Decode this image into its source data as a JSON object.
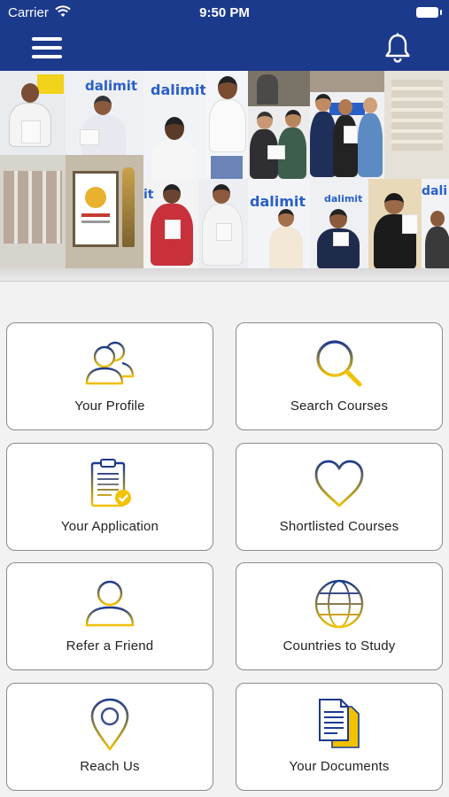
{
  "status_bar": {
    "carrier": "Carrier",
    "time": "9:50 PM",
    "wifi_icon": "wifi-icon",
    "battery_icon": "battery-icon"
  },
  "header": {
    "menu_icon": "hamburger-menu-icon",
    "notification_icon": "bell-icon",
    "background_color": "#1c3a8c"
  },
  "banner": {
    "logo_text": "dalimit",
    "logo_color": "#2a5fc8",
    "description_icons": "collage-photo"
  },
  "menu": {
    "items": [
      {
        "label": "Your Profile",
        "icon": "users-icon"
      },
      {
        "label": "Search Courses",
        "icon": "search-icon"
      },
      {
        "label": "Your Application",
        "icon": "clipboard-check-icon"
      },
      {
        "label": "Shortlisted Courses",
        "icon": "heart-icon"
      },
      {
        "label": "Refer a Friend",
        "icon": "user-icon"
      },
      {
        "label": "Countries to Study",
        "icon": "globe-icon"
      },
      {
        "label": "Reach Us",
        "icon": "location-pin-icon"
      },
      {
        "label": "Your Documents",
        "icon": "documents-icon"
      }
    ]
  },
  "colors": {
    "icon_gradient_top": "#1c3a8c",
    "icon_gradient_bottom": "#f2c200",
    "card_border": "#8a8a8a",
    "page_background": "#f2f2f2"
  }
}
